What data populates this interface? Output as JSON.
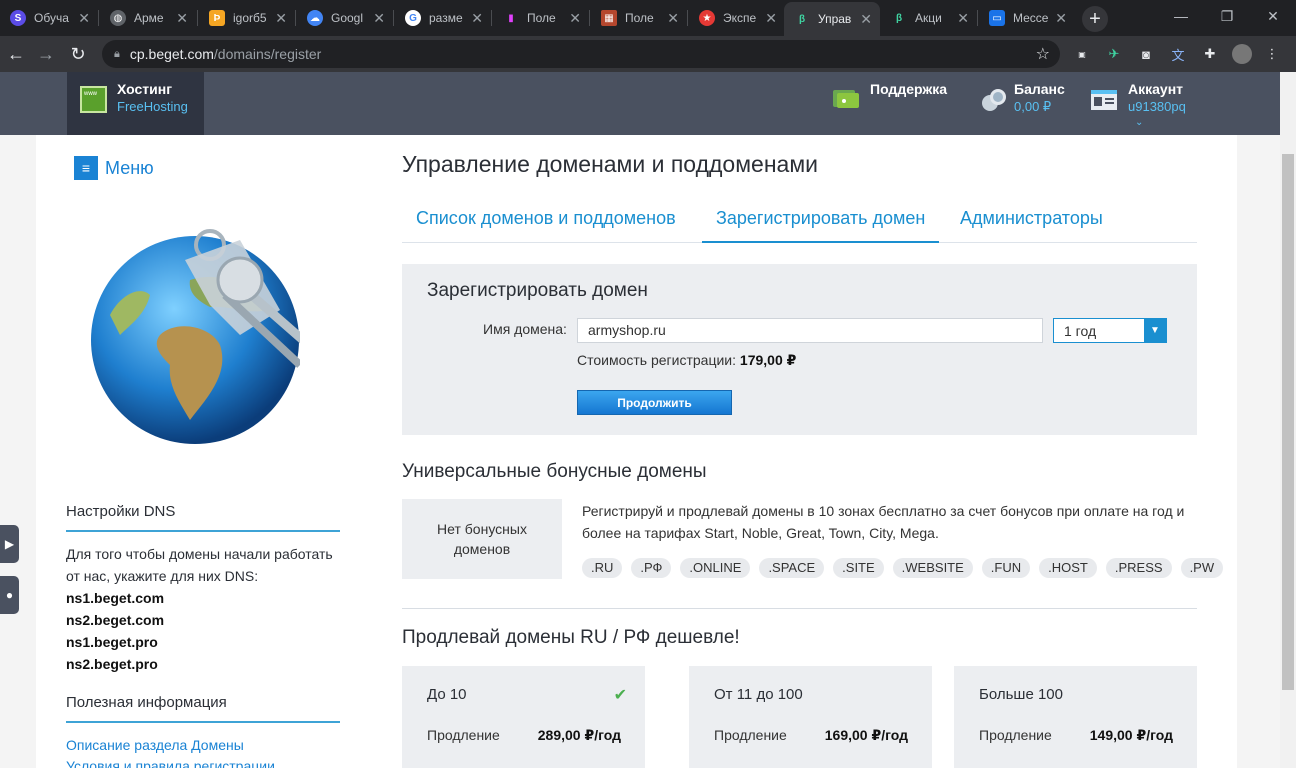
{
  "browser": {
    "tabs": [
      {
        "title": "Обуча",
        "fav_color": "#5b4ce6",
        "fav_glyph": "S"
      },
      {
        "title": "Арме",
        "fav_color": "#5f6368",
        "fav_glyph": "◍"
      },
      {
        "title": "igorб5",
        "fav_color": "#f5a623",
        "fav_glyph": "Þ"
      },
      {
        "title": "Googl",
        "fav_color": "#4285f4",
        "fav_glyph": "☁"
      },
      {
        "title": "разме",
        "fav_color": "#ffffff",
        "fav_glyph": "G"
      },
      {
        "title": "Поле",
        "fav_color": "#202124",
        "fav_glyph": "▮"
      },
      {
        "title": "Поле",
        "fav_color": "#b5472e",
        "fav_glyph": "▦"
      },
      {
        "title": "Экспе",
        "fav_color": "#e53935",
        "fav_glyph": "★"
      },
      {
        "title": "Управ",
        "fav_color": "#35363a",
        "fav_glyph": "β"
      },
      {
        "title": "Акци",
        "fav_color": "#202124",
        "fav_glyph": "β"
      },
      {
        "title": "Мессе",
        "fav_color": "#1a73e8",
        "fav_glyph": "▭"
      }
    ],
    "url_host": "cp.beget.com",
    "url_path": "/domains/register"
  },
  "header": {
    "brand_title": "Хостинг",
    "brand_subtitle": "FreeHosting",
    "support_label": "Поддержка",
    "balance_label": "Баланс",
    "balance_value": "0,00 ₽",
    "account_label": "Аккаунт",
    "account_value": "u91380pq"
  },
  "sidebar": {
    "menu_label": "Меню",
    "dns_title": "Настройки DNS",
    "dns_text": "Для того чтобы домены начали работать от нас, укажите для них DNS:",
    "ns": [
      "ns1.beget.com",
      "ns2.beget.com",
      "ns1.beget.pro",
      "ns2.beget.pro"
    ],
    "info_title": "Полезная информация",
    "links": [
      "Описание раздела Домены",
      "Условия и правила регистрации"
    ]
  },
  "main": {
    "title": "Управление доменами и поддоменами",
    "tabs": [
      {
        "label": "Список доменов и поддоменов"
      },
      {
        "label": "Зарегистрировать домен"
      },
      {
        "label": "Администраторы"
      }
    ],
    "register": {
      "title": "Зарегистрировать домен",
      "domain_label": "Имя домена:",
      "domain_value": "armyshop.ru",
      "period_value": "1 год",
      "cost_label": "Стоимость регистрации:",
      "cost_value": "179,00 ₽",
      "continue_label": "Продолжить"
    },
    "bonus": {
      "title": "Универсальные бонусные домены",
      "none_label": "Нет бонусных доменов",
      "text": "Регистрируй и продлевай домены в 10 зонах бесплатно за счет бонусов при оплате на год и более на тарифах Start, Noble, Great, Town, City, Mega.",
      "zones": [
        ".RU",
        ".РФ",
        ".ONLINE",
        ".SPACE",
        ".SITE",
        ".WEBSITE",
        ".FUN",
        ".HOST",
        ".PRESS",
        ".PW"
      ]
    },
    "renew": {
      "title": "Продлевай домены RU / РФ дешевле!",
      "cards": [
        {
          "title": "До 10",
          "label": "Продление",
          "price": "289,00 ₽/год",
          "checked": true
        },
        {
          "title": "От 11 до 100",
          "label": "Продление",
          "price": "169,00 ₽/год",
          "checked": false
        },
        {
          "title": "Больше 100",
          "label": "Продление",
          "price": "149,00 ₽/год",
          "checked": false
        }
      ]
    }
  }
}
